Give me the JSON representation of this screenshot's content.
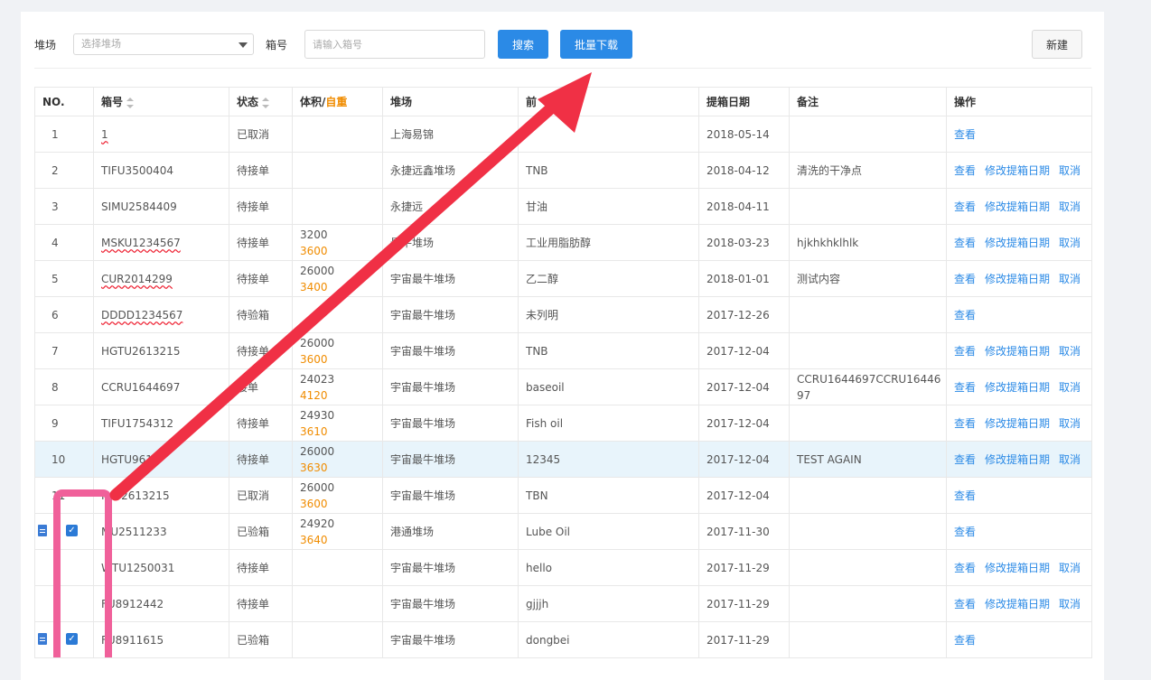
{
  "toolbar": {
    "yard_label": "堆场",
    "yard_placeholder": "选择堆场",
    "box_label": "箱号",
    "box_placeholder": "请输入箱号",
    "search_label": "搜索",
    "batch_download_label": "批量下载",
    "new_label": "新建"
  },
  "table": {
    "headers": {
      "no": "NO.",
      "box": "箱号",
      "status": "状态",
      "volume": "体积/",
      "weight": "自重",
      "yard": "堆场",
      "cargo": "前",
      "date": "提箱日期",
      "note": "备注",
      "ops": "操作"
    },
    "actions": {
      "view": "查看",
      "modify": "修改提箱日期",
      "cancel": "取消"
    },
    "rows": [
      {
        "no": "1",
        "box": "1",
        "status": "已取消",
        "vol": "",
        "wt": "",
        "yard": "上海易锦",
        "cargo": "",
        "date": "2018-05-14",
        "note": ""
      },
      {
        "no": "2",
        "box": "TIFU3500404",
        "status": "待接单",
        "vol": "",
        "wt": "",
        "yard": "永捷远鑫堆场",
        "cargo": "TNB",
        "date": "2018-04-12",
        "note": "清洗的干净点"
      },
      {
        "no": "3",
        "box": "SIMU2584409",
        "status": "待接单",
        "vol": "",
        "wt": "",
        "yard": "永捷远",
        "cargo": "甘油",
        "date": "2018-04-11",
        "note": ""
      },
      {
        "no": "4",
        "box": "MSKU1234567",
        "status": "待接单",
        "vol": "3200",
        "wt": "3600",
        "yard": "最牛堆场",
        "cargo": "工业用脂肪醇",
        "date": "2018-03-23",
        "note": "hjkhkhklhlk"
      },
      {
        "no": "5",
        "box": "CUR2014299",
        "status": "待接单",
        "vol": "26000",
        "wt": "3400",
        "yard": "宇宙最牛堆场",
        "cargo": "乙二醇",
        "date": "2018-01-01",
        "note": "测试内容"
      },
      {
        "no": "6",
        "box": "DDDD1234567",
        "status": "待验箱",
        "vol": "",
        "wt": "",
        "yard": "宇宙最牛堆场",
        "cargo": "未列明",
        "date": "2017-12-26",
        "note": ""
      },
      {
        "no": "7",
        "box": "HGTU2613215",
        "status": "待接单",
        "vol": "26000",
        "wt": "3600",
        "yard": "宇宙最牛堆场",
        "cargo": "TNB",
        "date": "2017-12-04",
        "note": ""
      },
      {
        "no": "8",
        "box": "CCRU1644697",
        "status": "接单",
        "vol": "24023",
        "wt": "4120",
        "yard": "宇宙最牛堆场",
        "cargo": "baseoil",
        "date": "2017-12-04",
        "note": "CCRU1644697CCRU1644697"
      },
      {
        "no": "9",
        "box": "TIFU1754312",
        "status": "待接单",
        "vol": "24930",
        "wt": "3610",
        "yard": "宇宙最牛堆场",
        "cargo": "Fish oil",
        "date": "2017-12-04",
        "note": ""
      },
      {
        "no": "10",
        "box": "HGTU961",
        "status": "待接单",
        "vol": "26000",
        "wt": "3630",
        "yard": "宇宙最牛堆场",
        "cargo": "12345",
        "date": "2017-12-04",
        "note": "TEST AGAIN"
      },
      {
        "no": "11",
        "box": "HG 2613215",
        "status": "已取消",
        "vol": "26000",
        "wt": "3600",
        "yard": "宇宙最牛堆场",
        "cargo": "TBN",
        "date": "2017-12-04",
        "note": ""
      },
      {
        "no": "",
        "box": "MU2511233",
        "status": "已验箱",
        "vol": "24920",
        "wt": "3640",
        "yard": "港通堆场",
        "cargo": "Lube Oil",
        "date": "2017-11-30",
        "note": ""
      },
      {
        "no": "",
        "box": "WTU1250031",
        "status": "待接单",
        "vol": "",
        "wt": "",
        "yard": "宇宙最牛堆场",
        "cargo": "hello",
        "date": "2017-11-29",
        "note": ""
      },
      {
        "no": "",
        "box": "FU8912442",
        "status": "待接单",
        "vol": "",
        "wt": "",
        "yard": "宇宙最牛堆场",
        "cargo": "gjjjh",
        "date": "2017-11-29",
        "note": ""
      },
      {
        "no": "",
        "box": "FU8911615",
        "status": "已验箱",
        "vol": "",
        "wt": "",
        "yard": "宇宙最牛堆场",
        "cargo": "dongbei",
        "date": "2017-11-29",
        "note": ""
      }
    ]
  }
}
